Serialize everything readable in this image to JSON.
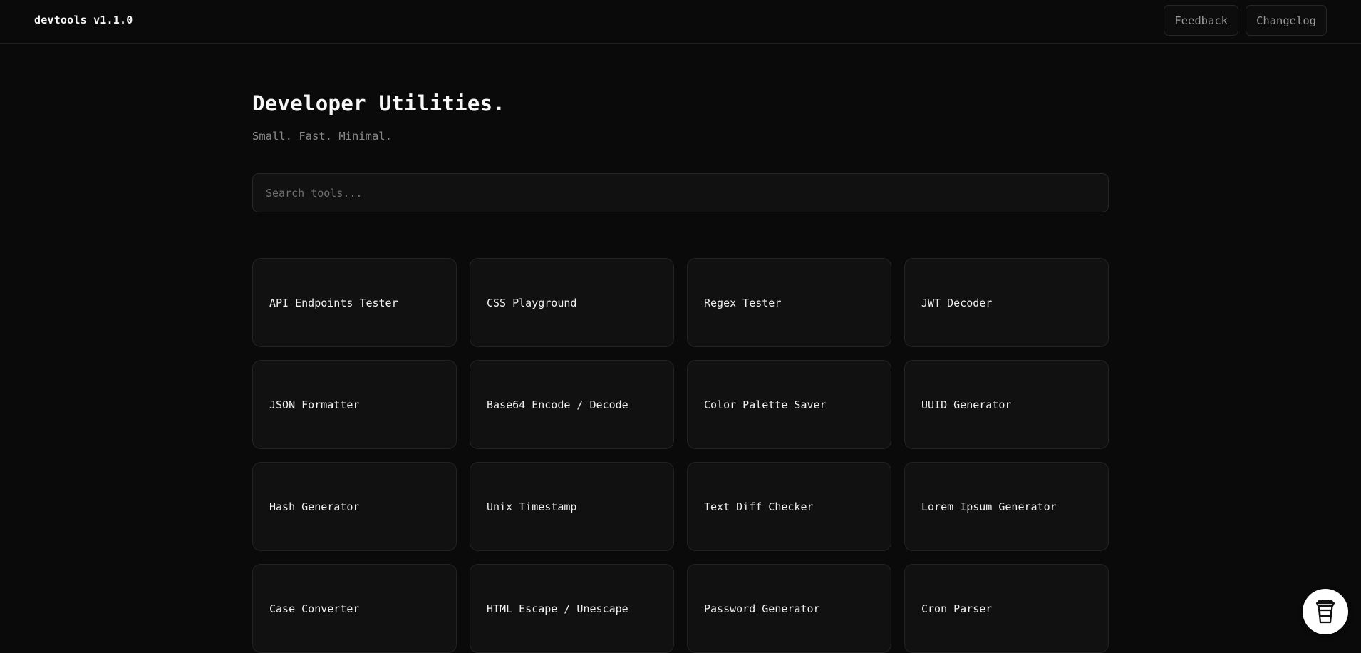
{
  "header": {
    "brand": "devtools v1.1.0",
    "nav": [
      {
        "label": "Feedback"
      },
      {
        "label": "Changelog"
      }
    ]
  },
  "hero": {
    "title": "Developer Utilities.",
    "subtitle": "Small. Fast. Minimal."
  },
  "search": {
    "placeholder": "Search tools...",
    "value": ""
  },
  "tools": [
    {
      "label": "API Endpoints Tester"
    },
    {
      "label": "CSS Playground"
    },
    {
      "label": "Regex Tester"
    },
    {
      "label": "JWT Decoder"
    },
    {
      "label": "JSON Formatter"
    },
    {
      "label": "Base64 Encode / Decode"
    },
    {
      "label": "Color Palette Saver"
    },
    {
      "label": "UUID Generator"
    },
    {
      "label": "Hash Generator"
    },
    {
      "label": "Unix Timestamp"
    },
    {
      "label": "Text Diff Checker"
    },
    {
      "label": "Lorem Ipsum Generator"
    },
    {
      "label": "Case Converter"
    },
    {
      "label": "HTML Escape / Unescape"
    },
    {
      "label": "Password Generator"
    },
    {
      "label": "Cron Parser"
    }
  ],
  "floating_button": {
    "icon": "coffee-cup-icon"
  },
  "colors": {
    "background": "#0a0a0a",
    "card": "#111111",
    "border": "#232323",
    "text": "#f0f0f0",
    "muted": "#8a8a8a"
  }
}
